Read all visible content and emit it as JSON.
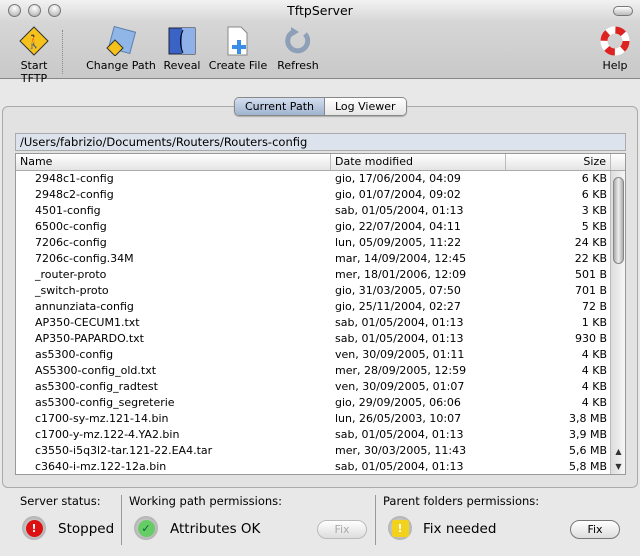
{
  "window": {
    "title": "TftpServer"
  },
  "toolbar": {
    "start": "Start TFTP",
    "change_path": "Change Path",
    "reveal": "Reveal",
    "create_file": "Create File",
    "refresh": "Refresh",
    "help": "Help"
  },
  "tabs": {
    "current_path": "Current Path",
    "log_viewer": "Log Viewer"
  },
  "path": "/Users/fabrizio/Documents/Routers/Routers-config",
  "table": {
    "headers": {
      "name": "Name",
      "date": "Date modified",
      "size": "Size"
    },
    "rows": [
      [
        "2948c1-config",
        "gio, 17/06/2004, 04:09",
        "6 KB"
      ],
      [
        "2948c2-config",
        "gio, 01/07/2004, 09:02",
        "6 KB"
      ],
      [
        "4501-config",
        "sab, 01/05/2004, 01:13",
        "3 KB"
      ],
      [
        "6500c-config",
        "gio, 22/07/2004, 04:11",
        "5 KB"
      ],
      [
        "7206c-config",
        "lun, 05/09/2005, 11:22",
        "24 KB"
      ],
      [
        "7206c-config.34M",
        "mar, 14/09/2004, 12:45",
        "22 KB"
      ],
      [
        "_router-proto",
        "mer, 18/01/2006, 12:09",
        "501 B"
      ],
      [
        "_switch-proto",
        "gio, 31/03/2005, 07:50",
        "701 B"
      ],
      [
        "annunziata-config",
        "gio, 25/11/2004, 02:27",
        "72 B"
      ],
      [
        "AP350-CECUM1.txt",
        "sab, 01/05/2004, 01:13",
        "1 KB"
      ],
      [
        "AP350-PAPARDO.txt",
        "sab, 01/05/2004, 01:13",
        "930 B"
      ],
      [
        "as5300-config",
        "ven, 30/09/2005, 01:11",
        "4 KB"
      ],
      [
        "AS5300-config_old.txt",
        "mer, 28/09/2005, 12:59",
        "4 KB"
      ],
      [
        "as5300-config_radtest",
        "ven, 30/09/2005, 01:07",
        "4 KB"
      ],
      [
        "as5300-config_segreterie",
        "gio, 29/09/2005, 06:06",
        "4 KB"
      ],
      [
        "c1700-sy-mz.121-14.bin",
        "lun, 26/05/2003, 10:07",
        "3,8 MB"
      ],
      [
        "c1700-y-mz.122-4.YA2.bin",
        "sab, 01/05/2004, 01:13",
        "3,9 MB"
      ],
      [
        "c3550-i5q3l2-tar.121-22.EA4.tar",
        "mer, 30/03/2005, 11:43",
        "5,6 MB"
      ],
      [
        "c3640-i-mz.122-12a.bin",
        "sab, 01/05/2004, 01:13",
        "5,8 MB"
      ]
    ]
  },
  "status": {
    "server_label": "Server status:",
    "server_value": "Stopped",
    "working_label": "Working path permissions:",
    "working_value": "Attributes OK",
    "working_fix": "Fix",
    "parent_label": "Parent folders permissions:",
    "parent_value": "Fix needed",
    "parent_fix": "Fix"
  }
}
